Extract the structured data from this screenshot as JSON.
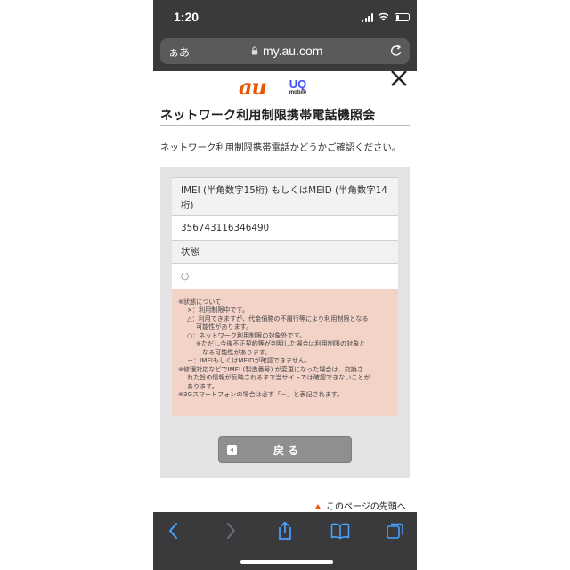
{
  "status_bar": {
    "time": "1:20"
  },
  "browser": {
    "text_size_label": "ぁあ",
    "domain": "my.au.com"
  },
  "page": {
    "logo_au": "au",
    "logo_uq_top": "UQ",
    "logo_uq_bottom": "mobile",
    "title": "ネットワーク利用制限携帯電話機照会",
    "intro": "ネットワーク利用制限携帯電話かどうかご確認ください。",
    "imei_label_line1": "IMEI (半角数字15桁) もしくはMEID (半角数字14",
    "imei_label_line2": "桁)",
    "imei_value": "356743116346490",
    "status_label": "状態",
    "status_value": "○",
    "notes": [
      "※状態について",
      "×：利用制限中です。",
      "△：利用できますが、代金債務の不履行等により利用制限となる",
      "可能性があります。",
      "○：ネットワーク利用制限の対象外です。",
      "※ただし今後不正契約等が判明した場合は利用制限の対象と",
      "なる可能性があります。",
      "－：IMEIもしくはMEIDが確認できません。",
      "※修理対応などでIMEI (製造番号) が変更になった場合は、交換さ",
      "れた旨の情報が反映されるまで当サイトでは確認できないことが",
      "あります。",
      "※3Gスマートフォンの場合は必ず「－」と表記されます。"
    ],
    "back_button": "戻る",
    "page_top_link": "このページの先頭へ"
  },
  "toolbar": {
    "icons": [
      "back-arrow-icon",
      "forward-arrow-icon",
      "share-icon",
      "bookmarks-icon",
      "tabs-icon"
    ]
  },
  "colors": {
    "au_orange": "#ea5504",
    "uq_blue": "#3d4cff",
    "notes_bg": "#f3d2c7",
    "chrome_dark": "#3a3a3c",
    "ios_blue": "#4aa0ff"
  }
}
